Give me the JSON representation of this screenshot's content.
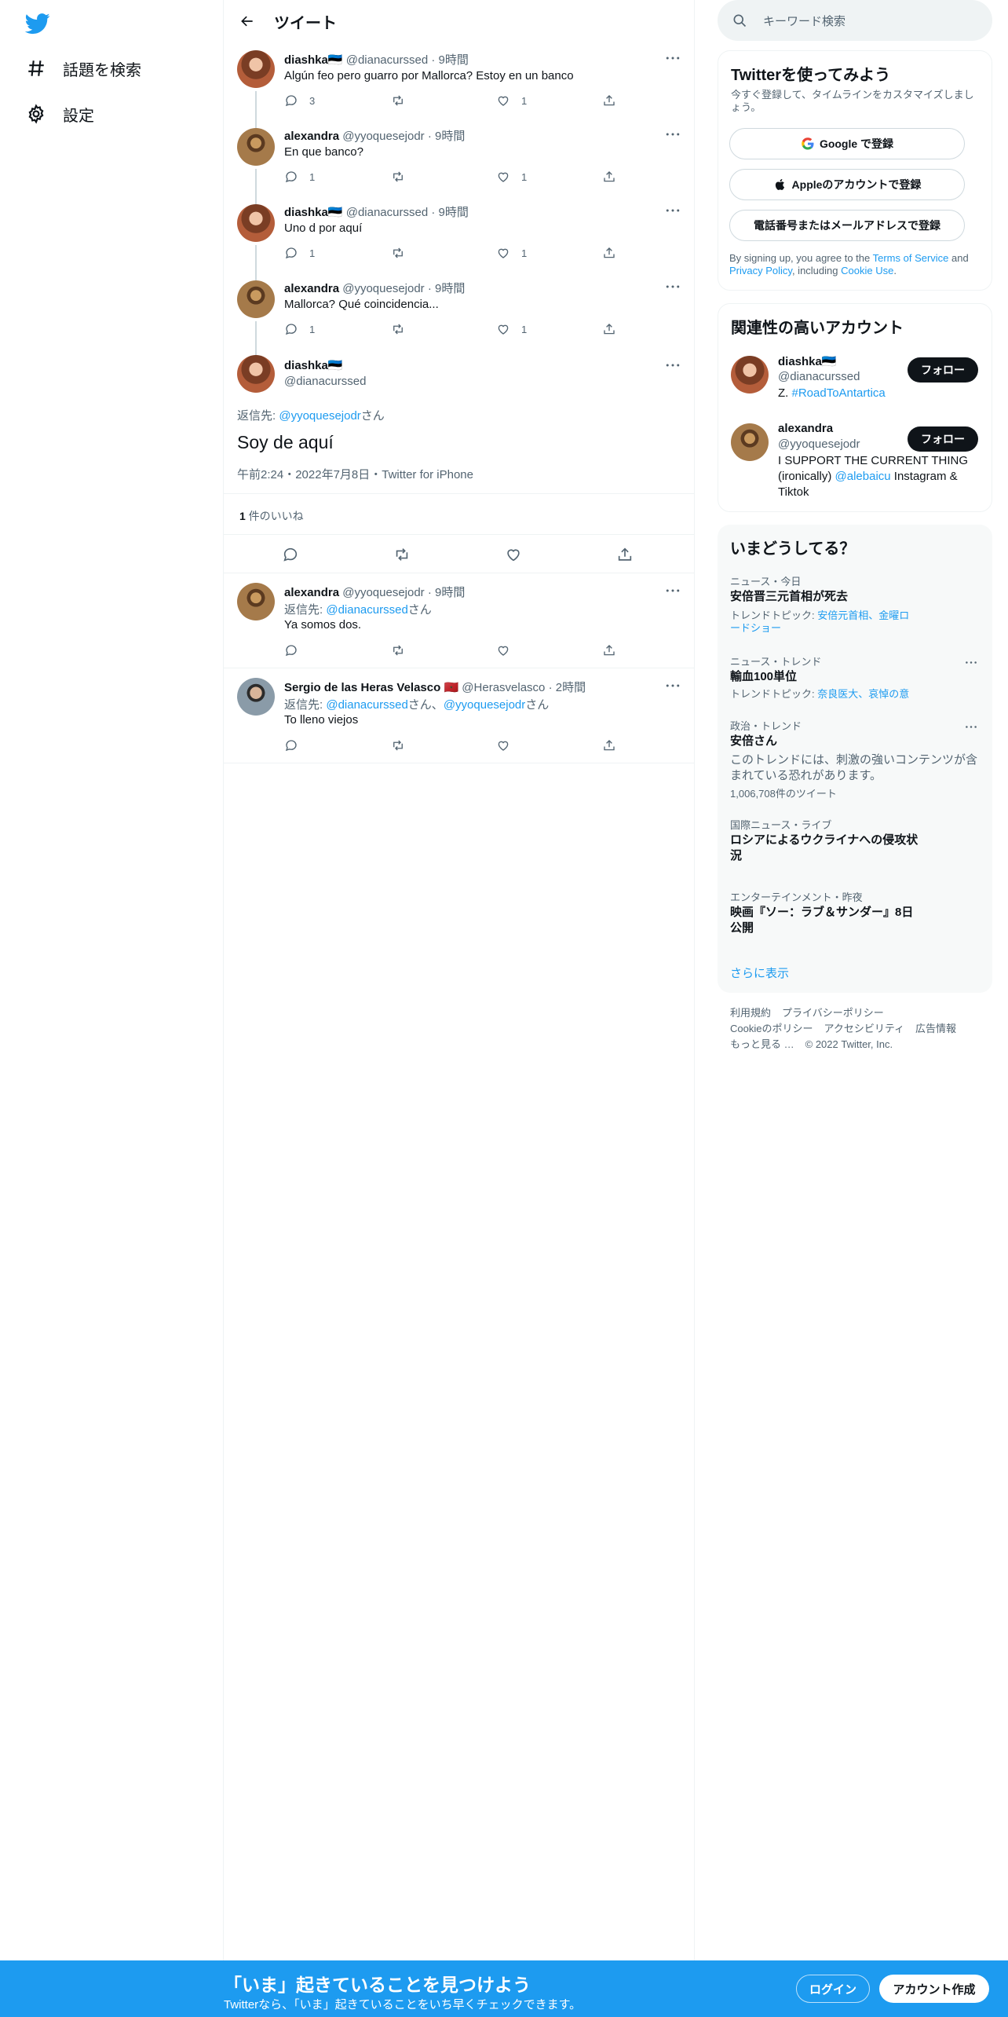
{
  "nav": {
    "explore_label": "話題を検索",
    "settings_label": "設定"
  },
  "header": {
    "title": "ツイート"
  },
  "thread": [
    {
      "name": "diashka🇪🇪",
      "handle": "@dianacurssed",
      "time": " · 9時間",
      "text": "Algún feo pero guarro por Mallorca? Estoy en un banco",
      "replies": "3",
      "retweets": "",
      "likes": "1"
    },
    {
      "name": "alexandra",
      "handle": "@yyoquesejodr",
      "time": " · 9時間",
      "text": "En que banco?",
      "replies": "1",
      "retweets": "",
      "likes": "1"
    },
    {
      "name": "diashka🇪🇪",
      "handle": "@dianacurssed",
      "time": " · 9時間",
      "text": "Uno d por aquí",
      "replies": "1",
      "retweets": "",
      "likes": "1"
    },
    {
      "name": "alexandra",
      "handle": "@yyoquesejodr",
      "time": " · 9時間",
      "text": "Mallorca? Qué coincidencia...",
      "replies": "1",
      "retweets": "",
      "likes": "1"
    }
  ],
  "focus": {
    "name": "diashka🇪🇪",
    "handle": "@dianacurssed",
    "reply_prefix": "返信先: ",
    "reply_to": "@yyoquesejodr",
    "reply_suffix": "さん",
    "text": "Soy de aquí",
    "meta": "午前2:24・2022年7月8日・Twitter for iPhone",
    "like_count": "1",
    "like_label": " 件のいいね"
  },
  "replies": [
    {
      "name": "alexandra",
      "handle": "@yyoquesejodr",
      "time": " · 9時間",
      "reply_prefix": "返信先: ",
      "reply_to_1": "@dianacurssed",
      "reply_mid": "さん",
      "reply_to_2": "",
      "reply_suffix": "",
      "text": "Ya somos dos."
    },
    {
      "name": "Sergio de las Heras Velasco 🇲🇦",
      "handle": "@Herasvelasco",
      "time": " · 2時間",
      "reply_prefix": "返信先: ",
      "reply_to_1": "@dianacurssed",
      "reply_mid": "さん、",
      "reply_to_2": "@yyoquesejodr",
      "reply_suffix": "さん",
      "text": "To lleno viejos"
    }
  ],
  "search": {
    "placeholder": "キーワード検索"
  },
  "signup": {
    "title": "Twitterを使ってみよう",
    "subtitle": "今すぐ登録して、タイムラインをカスタマイズしましょう。",
    "google": "Google で登録",
    "apple": "Appleのアカウントで登録",
    "phone": "電話番号またはメールアドレスで登録",
    "legal_1": "By signing up, you agree to the ",
    "tos": "Terms of Service",
    "legal_2": " and ",
    "privacy": "Privacy Policy",
    "legal_3": ", including ",
    "cookie": "Cookie Use",
    "legal_4": "."
  },
  "relevant": {
    "title": "関連性の高いアカウント",
    "follow_label": "フォロー",
    "accounts": [
      {
        "name": "diashka🇪🇪",
        "handle": "@dianacurssed",
        "bio_1": "Z. ",
        "bio_link": "#RoadToAntartica",
        "bio_2": ""
      },
      {
        "name": "alexandra",
        "handle": "@yyoquesejodr",
        "bio_1": "I SUPPORT THE CURRENT THING (ironically) ",
        "bio_link": "@alebaicu",
        "bio_2": " Instagram & Tiktok"
      }
    ]
  },
  "trends": {
    "title": "いまどうしてる？",
    "items": [
      {
        "category": "ニュース・今日",
        "title": "安倍晋三元首相が死去",
        "desc_prefix": "トレンドトピック: ",
        "desc_links": "安倍元首相、金曜ロードショー"
      },
      {
        "category": "ニュース・トレンド",
        "title": "輸血100単位",
        "desc_prefix": "トレンドトピック: ",
        "desc_links": "奈良医大、哀悼の意"
      },
      {
        "category": "政治・トレンド",
        "title": "安倍さん",
        "warning": "このトレンドには、刺激の強いコンテンツが含まれている恐れがあります。",
        "count": "1,006,708件のツイート"
      },
      {
        "category": "国際ニュース・ライブ",
        "title": "ロシアによるウクライナへの侵攻状況"
      },
      {
        "category": "エンターテインメント・昨夜",
        "title": "映画『ソー：ラブ＆サンダー』8日公開"
      }
    ],
    "show_more": "さらに表示"
  },
  "footer": {
    "terms": "利用規約",
    "privacy": "プライバシーポリシー",
    "cookie": "Cookieのポリシー",
    "accessibility": "アクセシビリティ",
    "ads": "広告情報",
    "more": "もっと見る …",
    "copyright": "© 2022 Twitter, Inc."
  },
  "banner": {
    "title": "「いま」起きていることを見つけよう",
    "subtitle": "Twitterなら、「いま」起きていることをいち早くチェックできます。",
    "login": "ログイン",
    "signup": "アカウント作成"
  },
  "colors": {
    "accent": "#1d9bf0",
    "text": "#0f1419",
    "muted": "#536471",
    "border": "#eff3f4"
  }
}
